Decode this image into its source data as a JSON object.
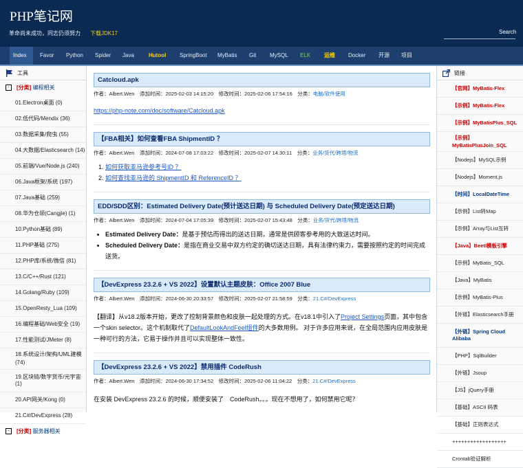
{
  "header": {
    "title": "PHP笔记网",
    "slogan": "革命尚未成功，同志仍须努力",
    "download_link": "下载JDK17",
    "search_label": "Search"
  },
  "nav": {
    "items": [
      {
        "label": "Index"
      },
      {
        "label": "Favor"
      },
      {
        "label": "Python"
      },
      {
        "label": "Spider"
      },
      {
        "label": "Java"
      },
      {
        "label": "Hutool"
      },
      {
        "label": "SpringBoot"
      },
      {
        "label": "MyBatis"
      },
      {
        "label": "Git"
      },
      {
        "label": "MySQL"
      },
      {
        "label": "ELK"
      },
      {
        "label": "运维"
      },
      {
        "label": "Docker"
      },
      {
        "label": "开源"
      },
      {
        "label": "项目"
      }
    ]
  },
  "left": {
    "heading": "工具",
    "category_box": "-",
    "category_tag": "[分类]",
    "category_label": "编程相关",
    "items": [
      "01.Electron桌面 (0)",
      "02.低代码/Mendix (36)",
      "03.数据采集/爬虫 (55)",
      "04.大数据/Elasticsearch (14)",
      "05.前端/Vue/Node.js (240)",
      "06.Java框架/系统 (197)",
      "07.Java基础 (259)",
      "08.华为仓颉(Cangjie) (1)",
      "10.Python基础 (89)",
      "11.PHP基础 (275)",
      "12.PHP库/系统/微信 (81)",
      "13.C/C++/Rust (121)",
      "14.Golang/Ruby (109)",
      "15.OpenResty_Lua (109)",
      "16.编程基础/Web安全 (19)",
      "17.性能测试/JMeter (8)",
      "18.系统设计/架构/UML建模 (74)",
      "19.区块链/数字货币/元宇宙 (1)",
      "20.API网关/Kong (0)",
      "21.C#/DevExpress (28)"
    ],
    "next_category_tag": "[分类]",
    "next_category_label": "服务器相关"
  },
  "articles": [
    {
      "title": "Catcloud.apk",
      "author": "作者：Albert.Wen",
      "added": "添加时间：2025-02-03 14:15:20",
      "modified": "修改时间：2025-02-06 17:54:16",
      "category_label": "分类：",
      "category": "电脑/软件使用",
      "link": "https://php-note.com/doc/software/Catcloud.apk"
    },
    {
      "title": "【FBA相关】如何查看FBA ShipmentID ？",
      "author": "作者：Albert.Wen",
      "added": "添加时间：2024-07-08 17:03:22",
      "modified": "修改时间：2025-02-07 14:30:11",
      "category_label": "分类：",
      "category": "业务/货代/跨境/物流",
      "items": [
        "如何获取亚马逊参考号ID ？",
        "如何查找亚马逊的 ShipmentID 和 ReferenceID ？"
      ]
    },
    {
      "title": "EDD/SDD区别：Estimated Delivery Date(预计送达日期) 与 Scheduled Delivery Date(预定送达日期)",
      "author": "作者：Albert.Wen",
      "added": "添加时间：2024-07-04 17:05:39",
      "modified": "修改时间：2025-02-07 15:43:48",
      "category_label": "分类：",
      "category": "业务/货代/跨境/物流",
      "bullets": [
        {
          "term": "Estimated Delivery Date：",
          "text": "是基于预估而得出的送达日期，通常是供顾客参考用的大致送达时间。"
        },
        {
          "term": "Scheduled Delivery Date：",
          "text": "是指在商业交易中双方约定的确切送达日期，具有法律约束力，需要按照约定的时间完成送货。"
        }
      ]
    },
    {
      "title": "【DevExpress 23.2.6 + VS 2022】设置默认主题皮肤：Office 2007 Blue",
      "author": "作者：Albert.Wen",
      "added": "添加时间：2024-06-30 20:33:57",
      "modified": "修改时间：2025-02-07 21:58:59",
      "category_label": "分类：",
      "category": "21.C#/DevExpress",
      "p1": "【翻译】从v18.2版本开始，更改了控制背景颜色和皮肤一起处理的方式。在v18.1中引入了",
      "p1_link": "Project Settings",
      "p2": "页面，其中包含一个skin selector。这个机制取代了",
      "p2_link": "DefaultLookAndFeel组件",
      "p3": "的大多数用例。 对于许多应用来说，在全局范围内应用皮肤是一种可行的方法，它易于操作并且可以实现整体一致性。"
    },
    {
      "title": "【DevExpress 23.2.6 + VS 2022】禁用插件 CodeRush",
      "author": "作者：Albert.Wen",
      "added": "添加时间：2024-06-30 17:34:52",
      "modified": "修改时间：2025-02-06 11:04:22",
      "category_label": "分类：",
      "category": "21.C#/DevExpress",
      "text": "在安装 DevExpress 23.2.6 的时候，顺便安装了　CodeRush。。。现在不想用了，如何禁用它呢？"
    }
  ],
  "right": {
    "heading": "链接",
    "items": [
      {
        "label": "【官网】MyBatis-Flex",
        "style": "red"
      },
      {
        "label": "【示例】MyBatis-Flex",
        "style": "red"
      },
      {
        "label": "【示例】MyBatisPlus_SQL",
        "style": "red"
      },
      {
        "label": "【示例】MyBatisPlusJoin_SQL",
        "style": "red"
      },
      {
        "label": "【Nodejs】MySQL示例",
        "style": "normal"
      },
      {
        "label": "【Nodejs】Moment.js",
        "style": "normal"
      },
      {
        "label": "【时间】LocalDateTime",
        "style": "blue"
      },
      {
        "label": "【示例】List转Map",
        "style": "normal"
      },
      {
        "label": "【示例】Array与List互转",
        "style": "normal"
      },
      {
        "label": "【Java】Beetl模板引擎",
        "style": "red"
      },
      {
        "label": "【示例】MyBatis_SQL",
        "style": "normal"
      },
      {
        "label": "【Java】MyBatis",
        "style": "normal"
      },
      {
        "label": "【示例】MyBatis-Plus",
        "style": "normal"
      },
      {
        "label": "【外链】Elasticsearch手册",
        "style": "normal"
      },
      {
        "label": "【外链】Spring Cloud Alibaba",
        "style": "blue"
      },
      {
        "label": "【PHP】SqlBuilder",
        "style": "normal"
      },
      {
        "label": "【外链】Jsoup",
        "style": "normal"
      },
      {
        "label": "【JS】jQuery手册",
        "style": "normal"
      },
      {
        "label": "【基础】ASCII 码表",
        "style": "normal"
      },
      {
        "label": "【基础】正则表达式",
        "style": "normal"
      },
      {
        "label": "++++++++++++++++++",
        "style": "normal"
      },
      {
        "label": "Crontab验证解析",
        "style": "normal"
      }
    ]
  },
  "colors": {
    "header_bg": "#0b2a52",
    "nav_bg": "#1e3f6e",
    "title_bg": "#d9ebfa",
    "link": "#1b57c4",
    "red_link": "#d00000"
  }
}
